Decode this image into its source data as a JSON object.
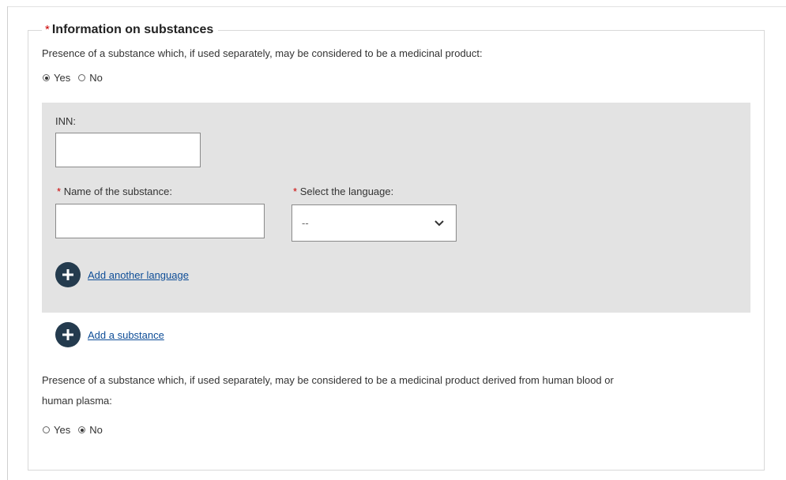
{
  "section": {
    "required_mark": "*",
    "title": "Information on substances"
  },
  "medicinal_question": {
    "label": "Presence of a substance which, if used separately, may be considered to be a medicinal product:",
    "options": [
      {
        "label": "Yes",
        "selected": true
      },
      {
        "label": "No",
        "selected": false
      }
    ]
  },
  "substance_panel": {
    "inn_label": "INN:",
    "inn_value": "",
    "name_required_mark": "*",
    "name_label": "Name of the substance:",
    "name_value": "",
    "language_required_mark": "*",
    "language_label": "Select the language:",
    "language_selected": "--",
    "add_language_label": "Add another language"
  },
  "add_substance_label": "Add a substance",
  "blood_question": {
    "label_line1": "Presence of a substance which, if used separately, may be considered to be a medicinal product derived from human blood or",
    "label_line2": "human plasma:",
    "options": [
      {
        "label": "Yes",
        "selected": false
      },
      {
        "label": "No",
        "selected": true
      }
    ]
  },
  "icons": {
    "plus": "plus-circle-icon",
    "dropdown": "chevron-down-icon"
  },
  "colors": {
    "required": "#cc0000",
    "link": "#0e4d97",
    "icon_bg": "#243b4e",
    "panel_bg": "#e3e3e3"
  }
}
